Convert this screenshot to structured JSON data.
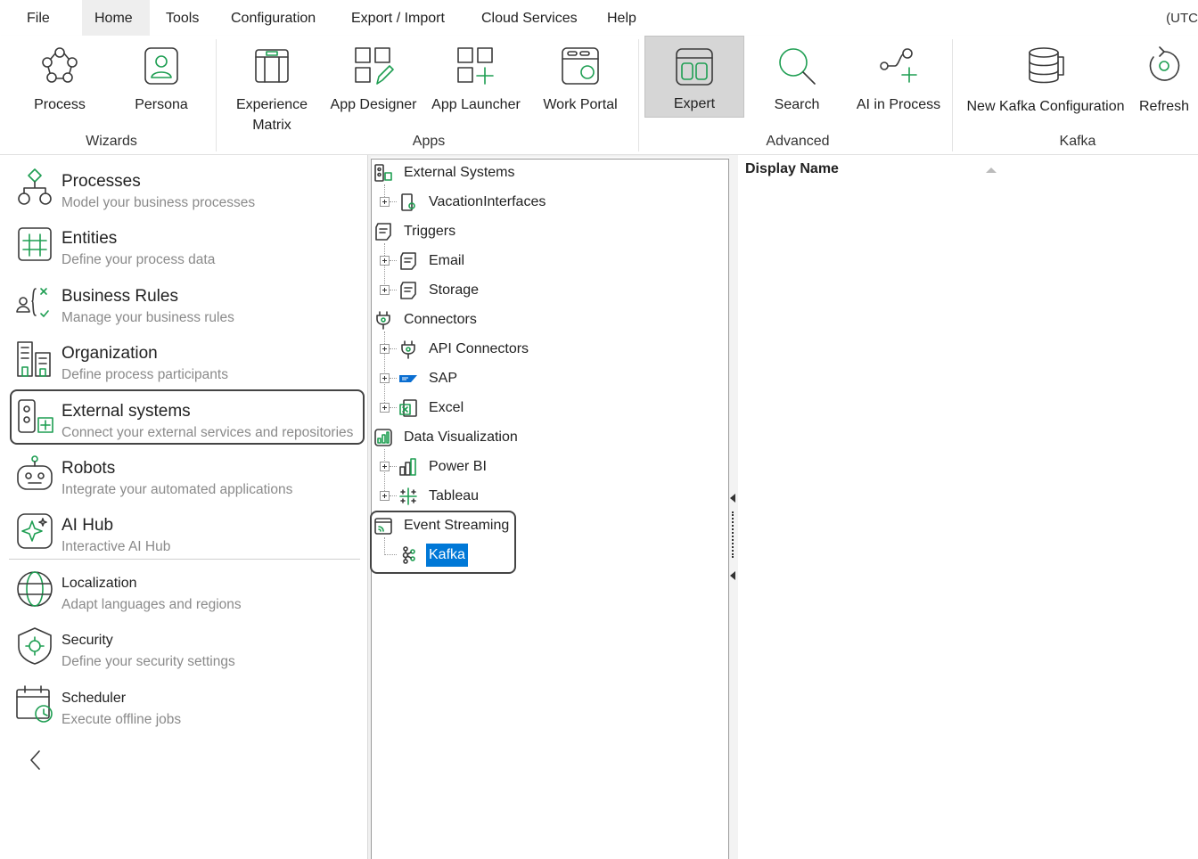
{
  "menu": {
    "items": [
      "File",
      "Home",
      "Tools",
      "Configuration",
      "Export / Import",
      "Cloud Services",
      "Help"
    ],
    "active": "Home",
    "timezone": "(UTC"
  },
  "ribbon": {
    "wizards": {
      "label": "Wizards",
      "process": "Process",
      "persona": "Persona"
    },
    "apps": {
      "label": "Apps",
      "experience_matrix_1": "Experience",
      "experience_matrix_2": "Matrix",
      "app_designer": "App Designer",
      "app_launcher": "App Launcher",
      "work_portal": "Work Portal"
    },
    "advanced": {
      "label": "Advanced",
      "expert": "Expert",
      "search": "Search",
      "ai_in_process": "AI in Process"
    },
    "kafka": {
      "label": "Kafka",
      "new_config": "New Kafka Configuration",
      "refresh": "Refresh"
    }
  },
  "left_panel": {
    "items": [
      {
        "title": "Processes",
        "desc": "Model your business processes",
        "icon": "processes-icon"
      },
      {
        "title": "Entities",
        "desc": "Define your process data",
        "icon": "entities-icon"
      },
      {
        "title": "Business Rules",
        "desc": "Manage your business rules",
        "icon": "business-rules-icon"
      },
      {
        "title": "Organization",
        "desc": "Define process participants",
        "icon": "organization-icon"
      },
      {
        "title": "External systems",
        "desc": "Connect your external services and repositories",
        "icon": "external-systems-icon"
      },
      {
        "title": "Robots",
        "desc": "Integrate your automated applications",
        "icon": "robots-icon"
      },
      {
        "title": "AI Hub",
        "desc": "Interactive AI Hub",
        "icon": "ai-hub-icon"
      },
      {
        "title": "Localization",
        "desc": "Adapt languages and regions",
        "icon": "localization-icon"
      },
      {
        "title": "Security",
        "desc": "Define your security settings",
        "icon": "security-icon"
      },
      {
        "title": "Scheduler",
        "desc": "Execute offline jobs",
        "icon": "scheduler-icon"
      }
    ]
  },
  "tree": {
    "external_systems": "External Systems",
    "vacation_interfaces": "VacationInterfaces",
    "triggers": "Triggers",
    "email": "Email",
    "storage": "Storage",
    "connectors": "Connectors",
    "api_connectors": "API Connectors",
    "sap": "SAP",
    "excel": "Excel",
    "data_visualization": "Data Visualization",
    "power_bi": "Power BI",
    "tableau": "Tableau",
    "event_streaming": "Event Streaming",
    "kafka": "Kafka"
  },
  "grid": {
    "column_display_name": "Display Name"
  },
  "colors": {
    "accent_green": "#1e9e52",
    "selection_blue": "#0078d7"
  }
}
